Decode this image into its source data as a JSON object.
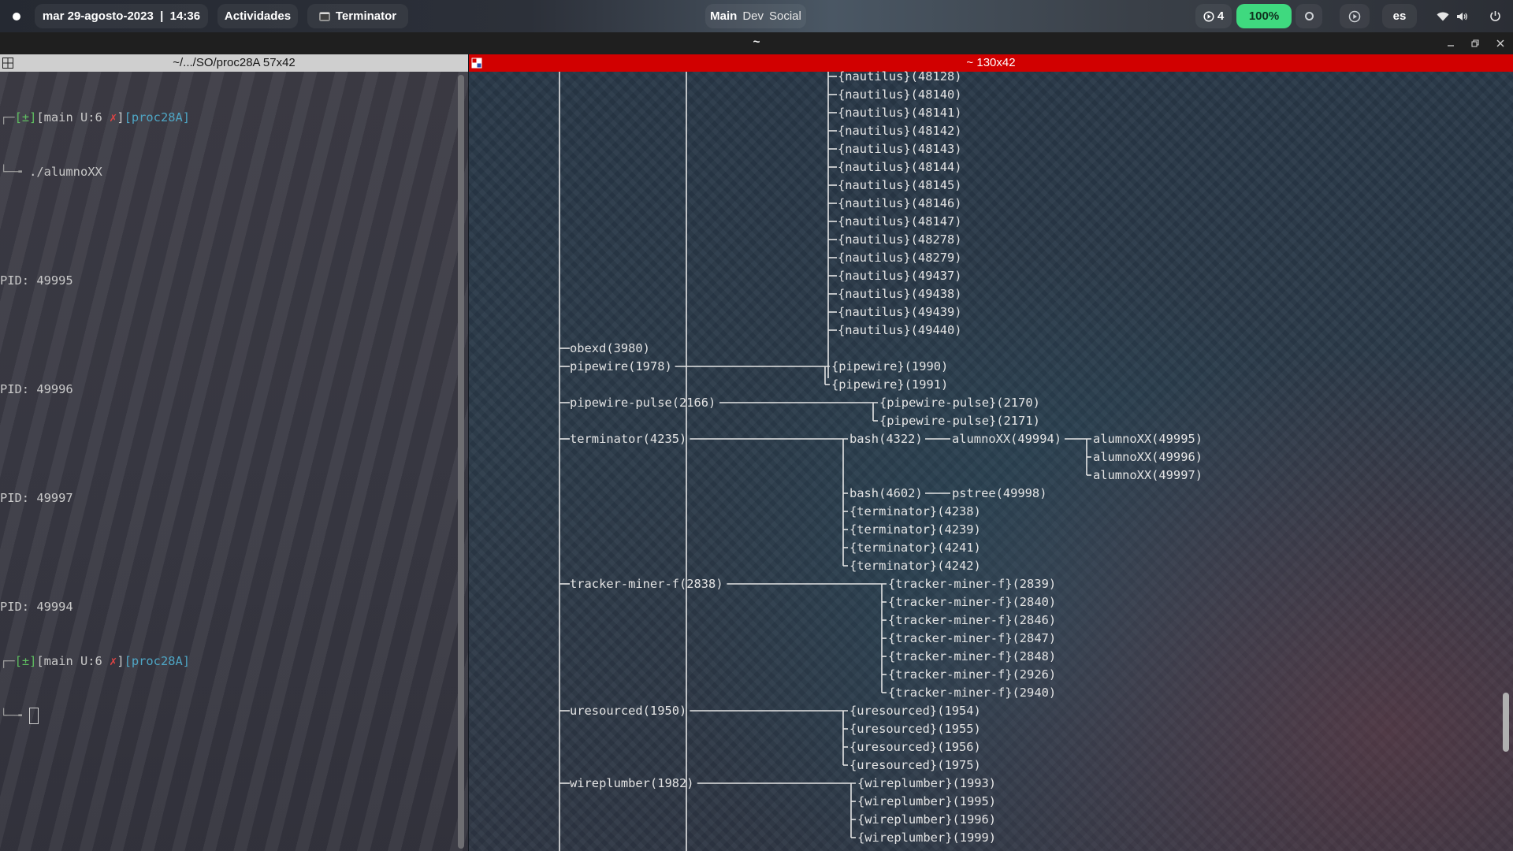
{
  "topbar": {
    "datetime": "mar 29-agosto-2023  |  14:36",
    "activities": "Actividades",
    "app_name": "Terminator",
    "workspaces": [
      "Main",
      "Dev",
      "Social"
    ],
    "updates_count": "4",
    "battery": "100%",
    "language": "es",
    "battery_color": "#3fd97f"
  },
  "window": {
    "title": "~",
    "left_pane_title": "~/.../SO/proc28A 57x42",
    "right_pane_title": "~ 130x42",
    "right_header_color": "#d10000"
  },
  "left_terminal": {
    "prompt_status": "[±]",
    "prompt_branch": "[main U:6 ",
    "prompt_x": "✗",
    "prompt_close": "]",
    "prompt_dir": "[proc28A]",
    "command": "./alumnoXX",
    "pid_lines": [
      "PID: 49995",
      "PID: 49996",
      "PID: 49997",
      "PID: 49994"
    ]
  },
  "right_terminal": {
    "nautilus_children": [
      "{nautilus}(48128)",
      "{nautilus}(48140)",
      "{nautilus}(48141)",
      "{nautilus}(48142)",
      "{nautilus}(48143)",
      "{nautilus}(48144)",
      "{nautilus}(48145)",
      "{nautilus}(48146)",
      "{nautilus}(48147)",
      "{nautilus}(48278)",
      "{nautilus}(48279)",
      "{nautilus}(49437)",
      "{nautilus}(49438)",
      "{nautilus}(49439)",
      "{nautilus}(49440)"
    ],
    "obexd": "obexd(3980)",
    "pipewire": {
      "name": "pipewire(1978)",
      "children": [
        "{pipewire}(1990)",
        "{pipewire}(1991)"
      ]
    },
    "pipewire_pulse": {
      "name": "pipewire-pulse(2166)",
      "children": [
        "{pipewire-pulse}(2170)",
        "{pipewire-pulse}(2171)"
      ]
    },
    "terminator": {
      "name": "terminator(4235)",
      "bash1": "bash(4322)",
      "alumno_parent": "alumnoXX(49994)",
      "alumno_children": [
        "alumnoXX(49995)",
        "alumnoXX(49996)",
        "alumnoXX(49997)"
      ],
      "bash2": "bash(4602)",
      "pstree": "pstree(49998)",
      "threads": [
        "{terminator}(4238)",
        "{terminator}(4239)",
        "{terminator}(4241)",
        "{terminator}(4242)"
      ]
    },
    "tracker": {
      "name": "tracker-miner-f(2838)",
      "children": [
        "{tracker-miner-f}(2839)",
        "{tracker-miner-f}(2840)",
        "{tracker-miner-f}(2846)",
        "{tracker-miner-f}(2847)",
        "{tracker-miner-f}(2848)",
        "{tracker-miner-f}(2926)",
        "{tracker-miner-f}(2940)"
      ]
    },
    "uresourced": {
      "name": "uresourced(1950)",
      "children": [
        "{uresourced}(1954)",
        "{uresourced}(1955)",
        "{uresourced}(1956)",
        "{uresourced}(1975)"
      ]
    },
    "wireplumber": {
      "name": "wireplumber(1982)",
      "children": [
        "{wireplumber}(1993)",
        "{wireplumber}(1995)",
        "{wireplumber}(1996)",
        "{wireplumber}(1999)"
      ]
    }
  }
}
